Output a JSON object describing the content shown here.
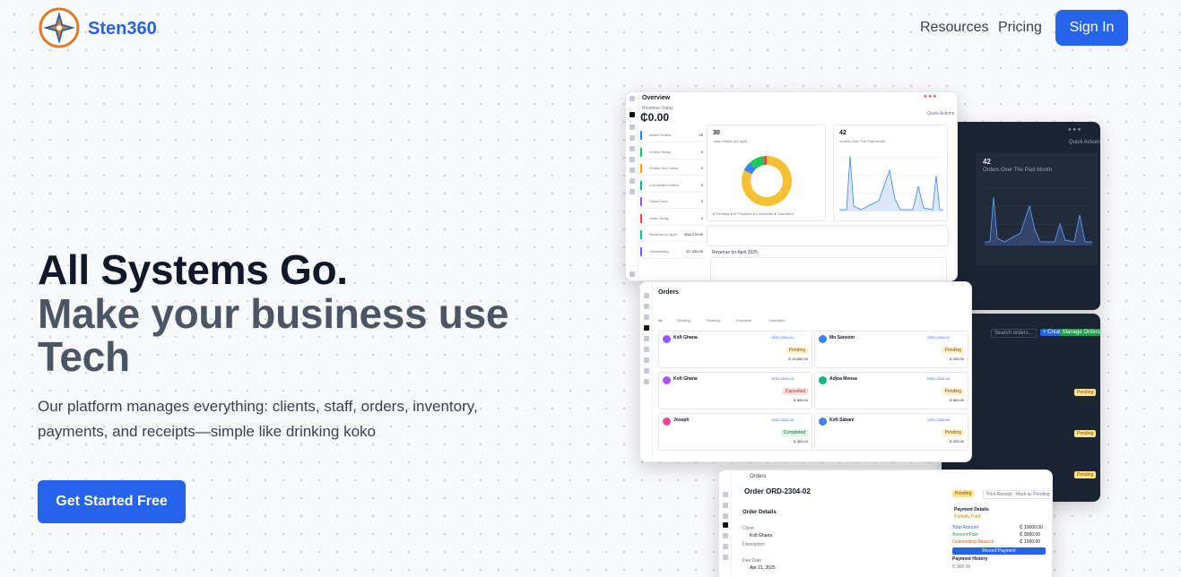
{
  "brand": {
    "name": "Sten360",
    "logo": "compass-logo"
  },
  "nav": {
    "resources": "Resources",
    "pricing": "Pricing",
    "signin": "Sign In"
  },
  "hero": {
    "headline": "All Systems Go.",
    "subheadline": "Make your business use Tech",
    "description": "Our platform manages everything: clients, staff, orders, inventory, payments, and receipts—simple like drinking koko",
    "cta": "Get Started Free"
  },
  "colors": {
    "primary": "#2563eb",
    "heading": "#111827",
    "subheading": "#4b5563"
  },
  "overview": {
    "title": "Overview",
    "revenue_label": "Revenue Today",
    "revenue_value": "₵0.00",
    "quick_actions": "Quick Actions",
    "stat1_value": "30",
    "stat1_label": "Total Orders (for age)",
    "stat2_value": "42",
    "stat2_label": "Orders Over The Past Month",
    "rows": [
      {
        "label": "Active Orders",
        "value": "25"
      },
      {
        "label": "Orders Today",
        "value": "0"
      },
      {
        "label": "Orders Due Today",
        "value": "0"
      },
      {
        "label": "Completed Orders",
        "value": "0"
      },
      {
        "label": "Sales Done",
        "value": "0"
      },
      {
        "label": "Sales Today",
        "value": "0"
      },
      {
        "label": "Revenue for April",
        "value": "₵53,279.00"
      },
      {
        "label": "Outstanding",
        "value": "₵7,530.00"
      }
    ],
    "revenue_month": "Revenue for April 2025",
    "dark_stat": "42",
    "dark_stat_label": "Orders Over The Past Month"
  },
  "orders": {
    "title": "Orders",
    "tabs": [
      "All",
      "Pending",
      "Pending",
      "Complete",
      "Cancelled"
    ],
    "cards": [
      {
        "name": "Kofi Ghana",
        "id": "ORD-2304-01",
        "amount": "₵ 19,500.00",
        "badge": "Pending"
      },
      {
        "name": "Mo Sansom",
        "id": "ORD-2304-02",
        "amount": "₵ 200.00",
        "badge": "Pending"
      },
      {
        "name": "Kofi Ghana",
        "id": "ORD-2304-03",
        "amount": "₵ 800.00",
        "badge": "Cancelled"
      },
      {
        "name": "Adjoa Mensa",
        "id": "ORD-2304-04",
        "amount": "₵ 800.00",
        "badge": "Pending"
      },
      {
        "name": "Joseph",
        "id": "ORD-2304-05",
        "amount": "₵ 300.00",
        "badge": "Completed"
      },
      {
        "name": "Kofi Sabani",
        "id": "ORD-2304-06",
        "amount": "₵ 200.00",
        "badge": "Pending"
      }
    ],
    "search": "Search orders...",
    "create": "+ Create",
    "manage": "Manage Orders"
  },
  "order_detail": {
    "crumb": "Orders",
    "title": "Order ORD-2304-02",
    "status": "Pending",
    "print": "Print Receipt",
    "mark": "Mark as Pending",
    "section": "Order Details",
    "client_label": "Client",
    "client": "Kofi Ghana",
    "desc_label": "Description",
    "due_label": "Due Date",
    "due": "Apr 21, 2025",
    "payment_title": "Payment Details",
    "payment_status": "Partially Paid",
    "total_label": "Total Amount",
    "total": "₵ 10000.00",
    "paid_label": "Amount Paid",
    "paid": "₵ 9000.00",
    "remaining_label": "Outstanding Balance",
    "remaining": "₵ 1000.00",
    "record": "Record Payment",
    "history": "Payment History",
    "history_amount": "₵ 900.00"
  },
  "chart_data": {
    "type": "pie",
    "categories": [
      "Pending",
      "In Progress",
      "Completed",
      "Cancelled"
    ],
    "values": [
      82,
      6,
      10,
      2
    ],
    "colors": [
      "#f5c033",
      "#3b82f6",
      "#22c55e",
      "#ef4444"
    ]
  }
}
